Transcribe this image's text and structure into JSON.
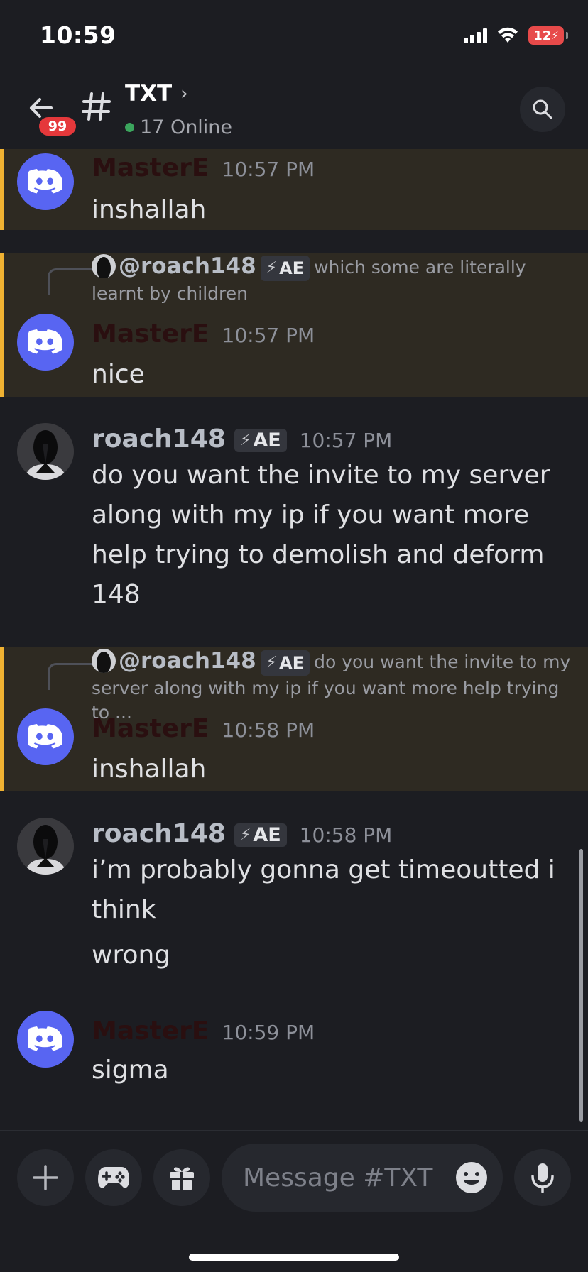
{
  "status_bar": {
    "time": "10:59",
    "battery": "12"
  },
  "header": {
    "back_badge": "99",
    "channel_name": "TXT",
    "online_text": "17 Online"
  },
  "messages": [
    {
      "author": "MasterE",
      "timestamp": "10:57 PM",
      "text": "inshallah"
    },
    {
      "reply": {
        "author": "@roach148",
        "tag": "AE",
        "text": "which some are literally learnt by children"
      },
      "author": "MasterE",
      "timestamp": "10:57 PM",
      "text": "nice"
    },
    {
      "author": "roach148",
      "tag": "AE",
      "timestamp": "10:57 PM",
      "text": "do you want the invite to my server along with my ip if you want more help trying to demolish and deform 148"
    },
    {
      "reply": {
        "author": "@roach148",
        "tag": "AE",
        "text": "do you want the invite to my server along with my ip if you want more help trying to ..."
      },
      "author": "MasterE",
      "timestamp": "10:58 PM",
      "text": "inshallah"
    },
    {
      "author": "roach148",
      "tag": "AE",
      "timestamp": "10:58 PM",
      "text": "i’m probably gonna get timeoutted i think",
      "text2": "wrong"
    },
    {
      "author": "MasterE",
      "timestamp": "10:59 PM",
      "text": "sigma"
    }
  ],
  "composer": {
    "placeholder": "Message #TXT"
  },
  "icons": {
    "back": "arrow-left-icon",
    "channel": "hashtag-icon",
    "search": "search-icon",
    "add": "plus-icon",
    "games": "gamepad-icon",
    "gift": "gift-icon",
    "emoji": "emoji-icon",
    "mic": "microphone-icon"
  },
  "colors": {
    "highlight_bar": "#f0b232",
    "discord_blurple": "#5865f2",
    "badge_red": "#e5383b",
    "online_green": "#3ba55d"
  }
}
